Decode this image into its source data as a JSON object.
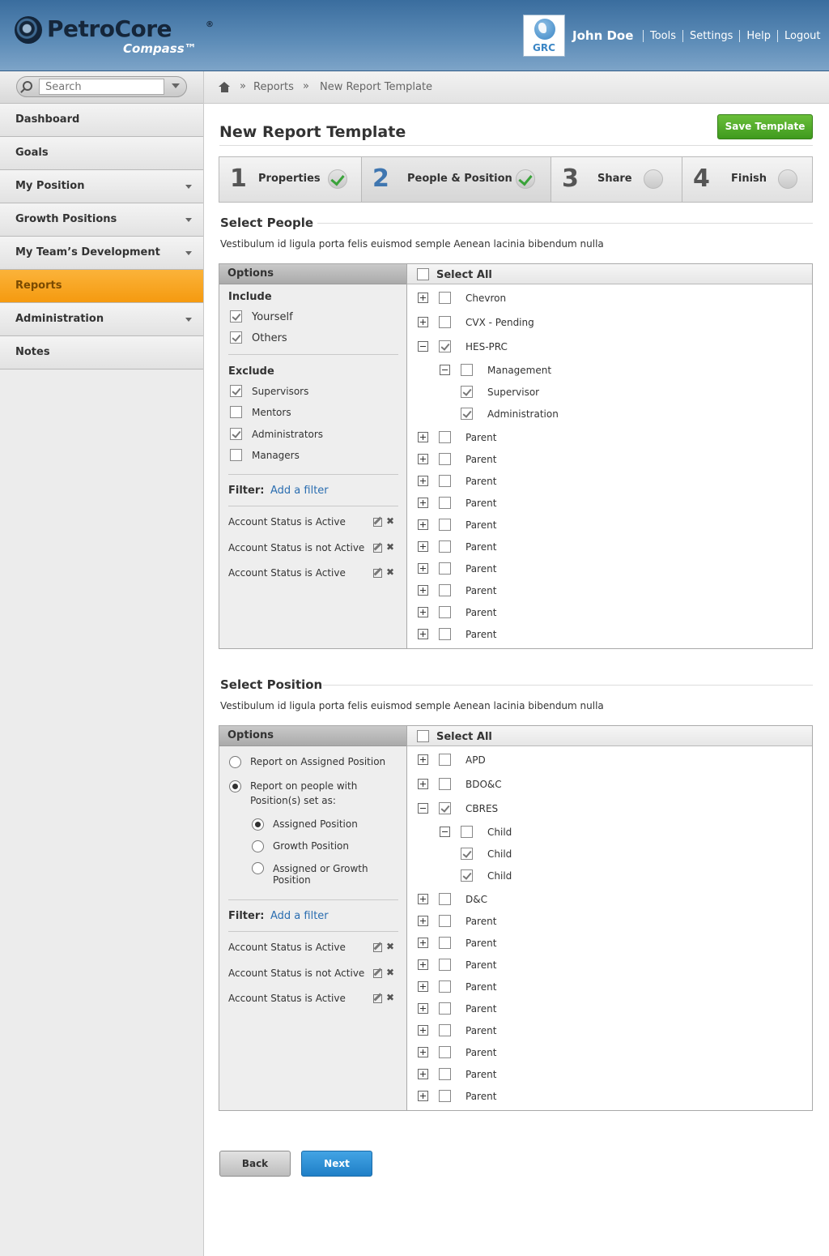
{
  "header": {
    "logo_text": "PetroCore",
    "logo_reg": "®",
    "logo_sub": "Compass™",
    "badge": "GRC",
    "user_name": "John Doe",
    "links": [
      "Tools",
      "Settings",
      "Help",
      "Logout"
    ]
  },
  "sidebar": {
    "search_placeholder": "Search",
    "items": [
      {
        "label": "Dashboard"
      },
      {
        "label": "Goals"
      },
      {
        "label": "My Position"
      },
      {
        "label": "Growth Positions"
      },
      {
        "label": "My Team’s Development"
      },
      {
        "label": "Reports"
      },
      {
        "label": "Administration"
      },
      {
        "label": "Notes"
      }
    ]
  },
  "breadcrumb": {
    "sep": "»",
    "items": [
      "Reports",
      "New Report Template"
    ]
  },
  "page": {
    "title": "New Report Template",
    "save_label": "Save Template"
  },
  "steps": [
    {
      "num": "1",
      "label": "Properties",
      "done": true
    },
    {
      "num": "2",
      "label": "People & Position",
      "done": true
    },
    {
      "num": "3",
      "label": "Share",
      "done": false
    },
    {
      "num": "4",
      "label": "Finish",
      "done": false
    }
  ],
  "people": {
    "title": "Select People",
    "desc": "Vestibulum id ligula porta felis euismod semple Aenean lacinia bibendum nulla",
    "options_label": "Options",
    "select_all": "Select All",
    "include_label": "Include",
    "include": [
      {
        "label": "Yourself",
        "checked": true
      },
      {
        "label": "Others",
        "checked": true
      }
    ],
    "exclude_label": "Exclude",
    "exclude": [
      {
        "label": "Supervisors",
        "checked": true
      },
      {
        "label": "Mentors",
        "checked": false
      },
      {
        "label": "Administrators",
        "checked": true
      },
      {
        "label": "Managers",
        "checked": false
      }
    ],
    "filter_label": "Filter:",
    "add_filter": "Add a filter",
    "filters": [
      "Account Status is Active",
      "Account Status is not Active",
      "Account Status is Active"
    ],
    "tree": [
      {
        "label": "Chevron"
      },
      {
        "label": "CVX - Pending"
      },
      {
        "label": "HES-PRC"
      },
      {
        "label": "Management"
      },
      {
        "label": "Supervisor"
      },
      {
        "label": "Administration"
      },
      {
        "label": "Parent"
      },
      {
        "label": "Parent"
      },
      {
        "label": "Parent"
      },
      {
        "label": "Parent"
      },
      {
        "label": "Parent"
      },
      {
        "label": "Parent"
      },
      {
        "label": "Parent"
      },
      {
        "label": "Parent"
      },
      {
        "label": "Parent"
      },
      {
        "label": "Parent"
      }
    ]
  },
  "position": {
    "title": "Select Position",
    "desc": "Vestibulum id ligula porta felis euismod semple Aenean lacinia bibendum nulla",
    "options_label": "Options",
    "select_all": "Select All",
    "radio_assigned": "Report on Assigned Position",
    "radio_people_1": "Report on people with",
    "radio_people_2": "Position(s) set as:",
    "sub_assigned": "Assigned Position",
    "sub_growth": "Growth Position",
    "sub_either_1": "Assigned or Growth",
    "sub_either_2": "Position",
    "filter_label": "Filter:",
    "add_filter": "Add a filter",
    "filters": [
      "Account Status is Active",
      "Account Status is not Active",
      "Account Status is Active"
    ],
    "tree": [
      {
        "label": "APD"
      },
      {
        "label": "BDO&C"
      },
      {
        "label": "CBRES"
      },
      {
        "label": "Child"
      },
      {
        "label": "Child"
      },
      {
        "label": "Child"
      },
      {
        "label": "D&C"
      },
      {
        "label": "Parent"
      },
      {
        "label": "Parent"
      },
      {
        "label": "Parent"
      },
      {
        "label": "Parent"
      },
      {
        "label": "Parent"
      },
      {
        "label": "Parent"
      },
      {
        "label": "Parent"
      },
      {
        "label": "Parent"
      },
      {
        "label": "Parent"
      }
    ]
  },
  "footer": {
    "back_label": "Back",
    "next_label": "Next"
  }
}
